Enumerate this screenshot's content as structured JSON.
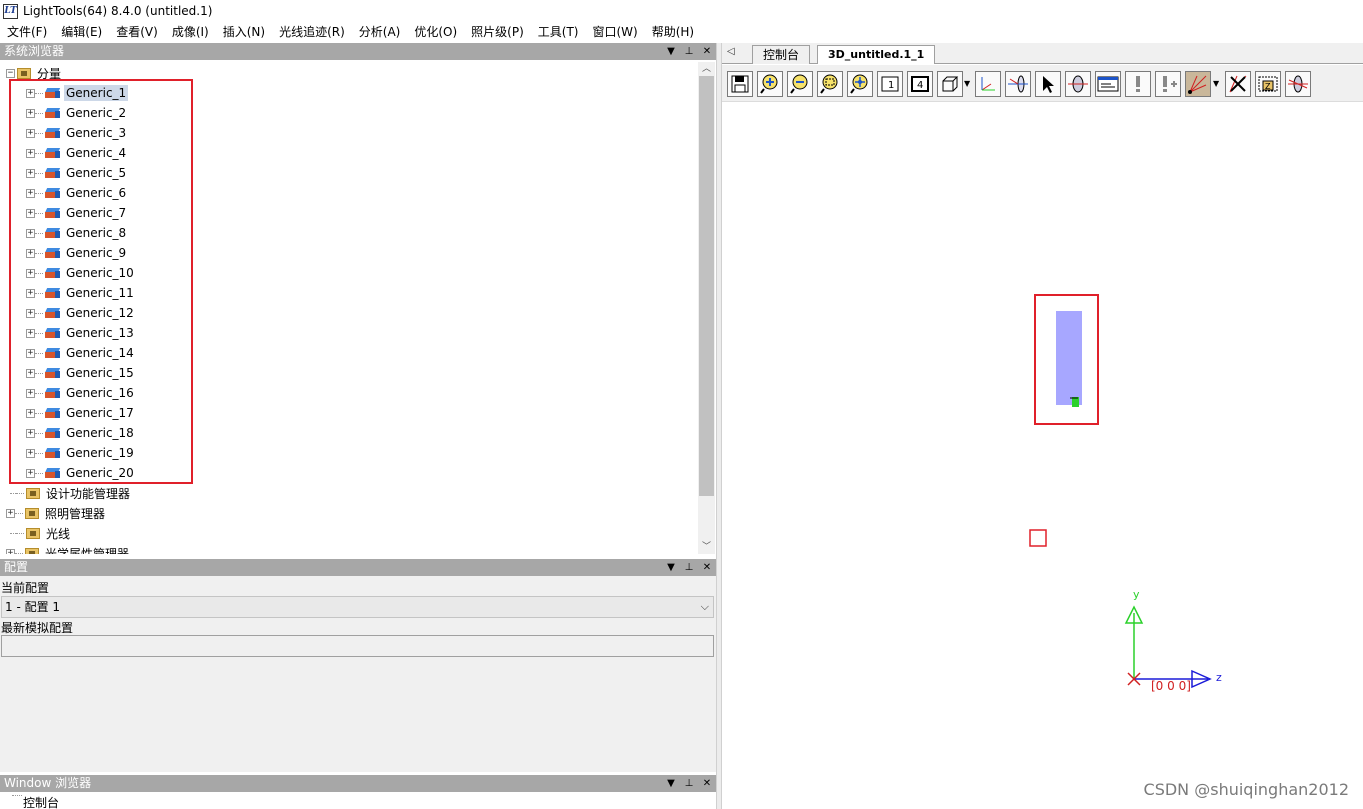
{
  "window": {
    "title": "LightTools(64) 8.4.0   (untitled.1)",
    "icon_text": "LT"
  },
  "menu": [
    "文件(F)",
    "编辑(E)",
    "查看(V)",
    "成像(I)",
    "插入(N)",
    "光线追迹(R)",
    "分析(A)",
    "优化(O)",
    "照片级(P)",
    "工具(T)",
    "窗口(W)",
    "帮助(H)"
  ],
  "panels": {
    "system_browser": {
      "title": "系统浏览器"
    },
    "config": {
      "title": "配置",
      "current_label": "当前配置",
      "current_value": "1 - 配置 1",
      "latest_label": "最新模拟配置",
      "latest_value": ""
    },
    "window_browser": {
      "title": "Window 浏览器",
      "item": "控制台"
    }
  },
  "tree": {
    "root": "分量",
    "components": [
      "Generic_1",
      "Generic_2",
      "Generic_3",
      "Generic_4",
      "Generic_5",
      "Generic_6",
      "Generic_7",
      "Generic_8",
      "Generic_9",
      "Generic_10",
      "Generic_11",
      "Generic_12",
      "Generic_13",
      "Generic_14",
      "Generic_15",
      "Generic_16",
      "Generic_17",
      "Generic_18",
      "Generic_19",
      "Generic_20"
    ],
    "selected": "Generic_1",
    "others": [
      "设计功能管理器",
      "照明管理器",
      "光线",
      "光学属性管理器"
    ]
  },
  "tabs": [
    "控制台",
    "3D_untitled.1_1"
  ],
  "active_tab": "3D_untitled.1_1",
  "axes": {
    "y_label": "y",
    "z_label": "z",
    "origin_label": "[0 0 0]"
  },
  "colors": {
    "accent_red": "#e0202a",
    "object_fill": "#a7a7ff",
    "axis_y": "#2bd12b",
    "axis_z": "#1b1bd8"
  },
  "watermark": "CSDN @shuiqinghan2012"
}
